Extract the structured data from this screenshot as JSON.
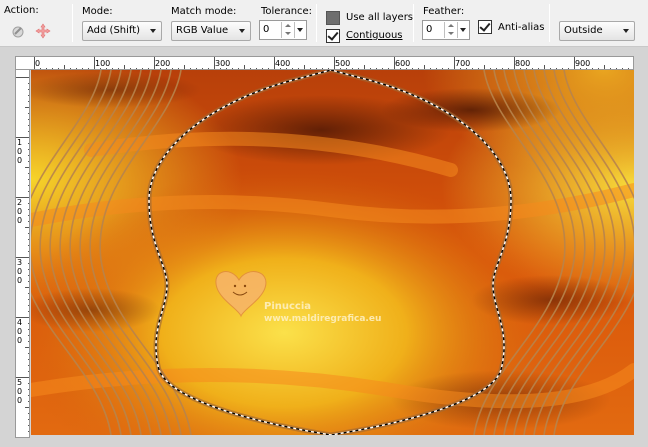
{
  "toolbar": {
    "action": {
      "label": "Action:",
      "tools": [
        {
          "name": "magic-wand-icon"
        },
        {
          "name": "move-cross-icon"
        }
      ]
    },
    "mode": {
      "label": "Mode:",
      "value": "Add (Shift)"
    },
    "match_mode": {
      "label": "Match mode:",
      "value": "RGB Value"
    },
    "tolerance": {
      "label": "Tolerance:",
      "value": "0"
    },
    "use_all_layers": {
      "label": "Use all layers",
      "checked": false
    },
    "contiguous": {
      "label": "Contiguous",
      "checked": true
    },
    "feather": {
      "label": "Feather:",
      "value": "0"
    },
    "anti_alias": {
      "label": "Anti-alias",
      "checked": true
    },
    "anti_alias_mode": {
      "value": "Outside"
    }
  },
  "ruler": {
    "horizontal_labels": [
      "0",
      "100",
      "200",
      "300",
      "400",
      "500",
      "600",
      "700",
      "800",
      "900"
    ],
    "vertical_labels": [
      [
        "1",
        "0",
        "0"
      ],
      [
        "2",
        "0",
        "0"
      ],
      [
        "3",
        "0",
        "0"
      ],
      [
        "4",
        "0",
        "0"
      ],
      [
        "5",
        "0",
        "0"
      ]
    ]
  },
  "watermark": {
    "name": "Pinuccia",
    "url": "www.maldiregrafica.eu"
  },
  "colors": {
    "toolbar_bg": "#f0f0f0",
    "workspace_bg": "#d4d4d4",
    "canvas_orange": "#d9540a",
    "canvas_yellow": "#f2c21e",
    "frame_lines": "#b8844c"
  }
}
